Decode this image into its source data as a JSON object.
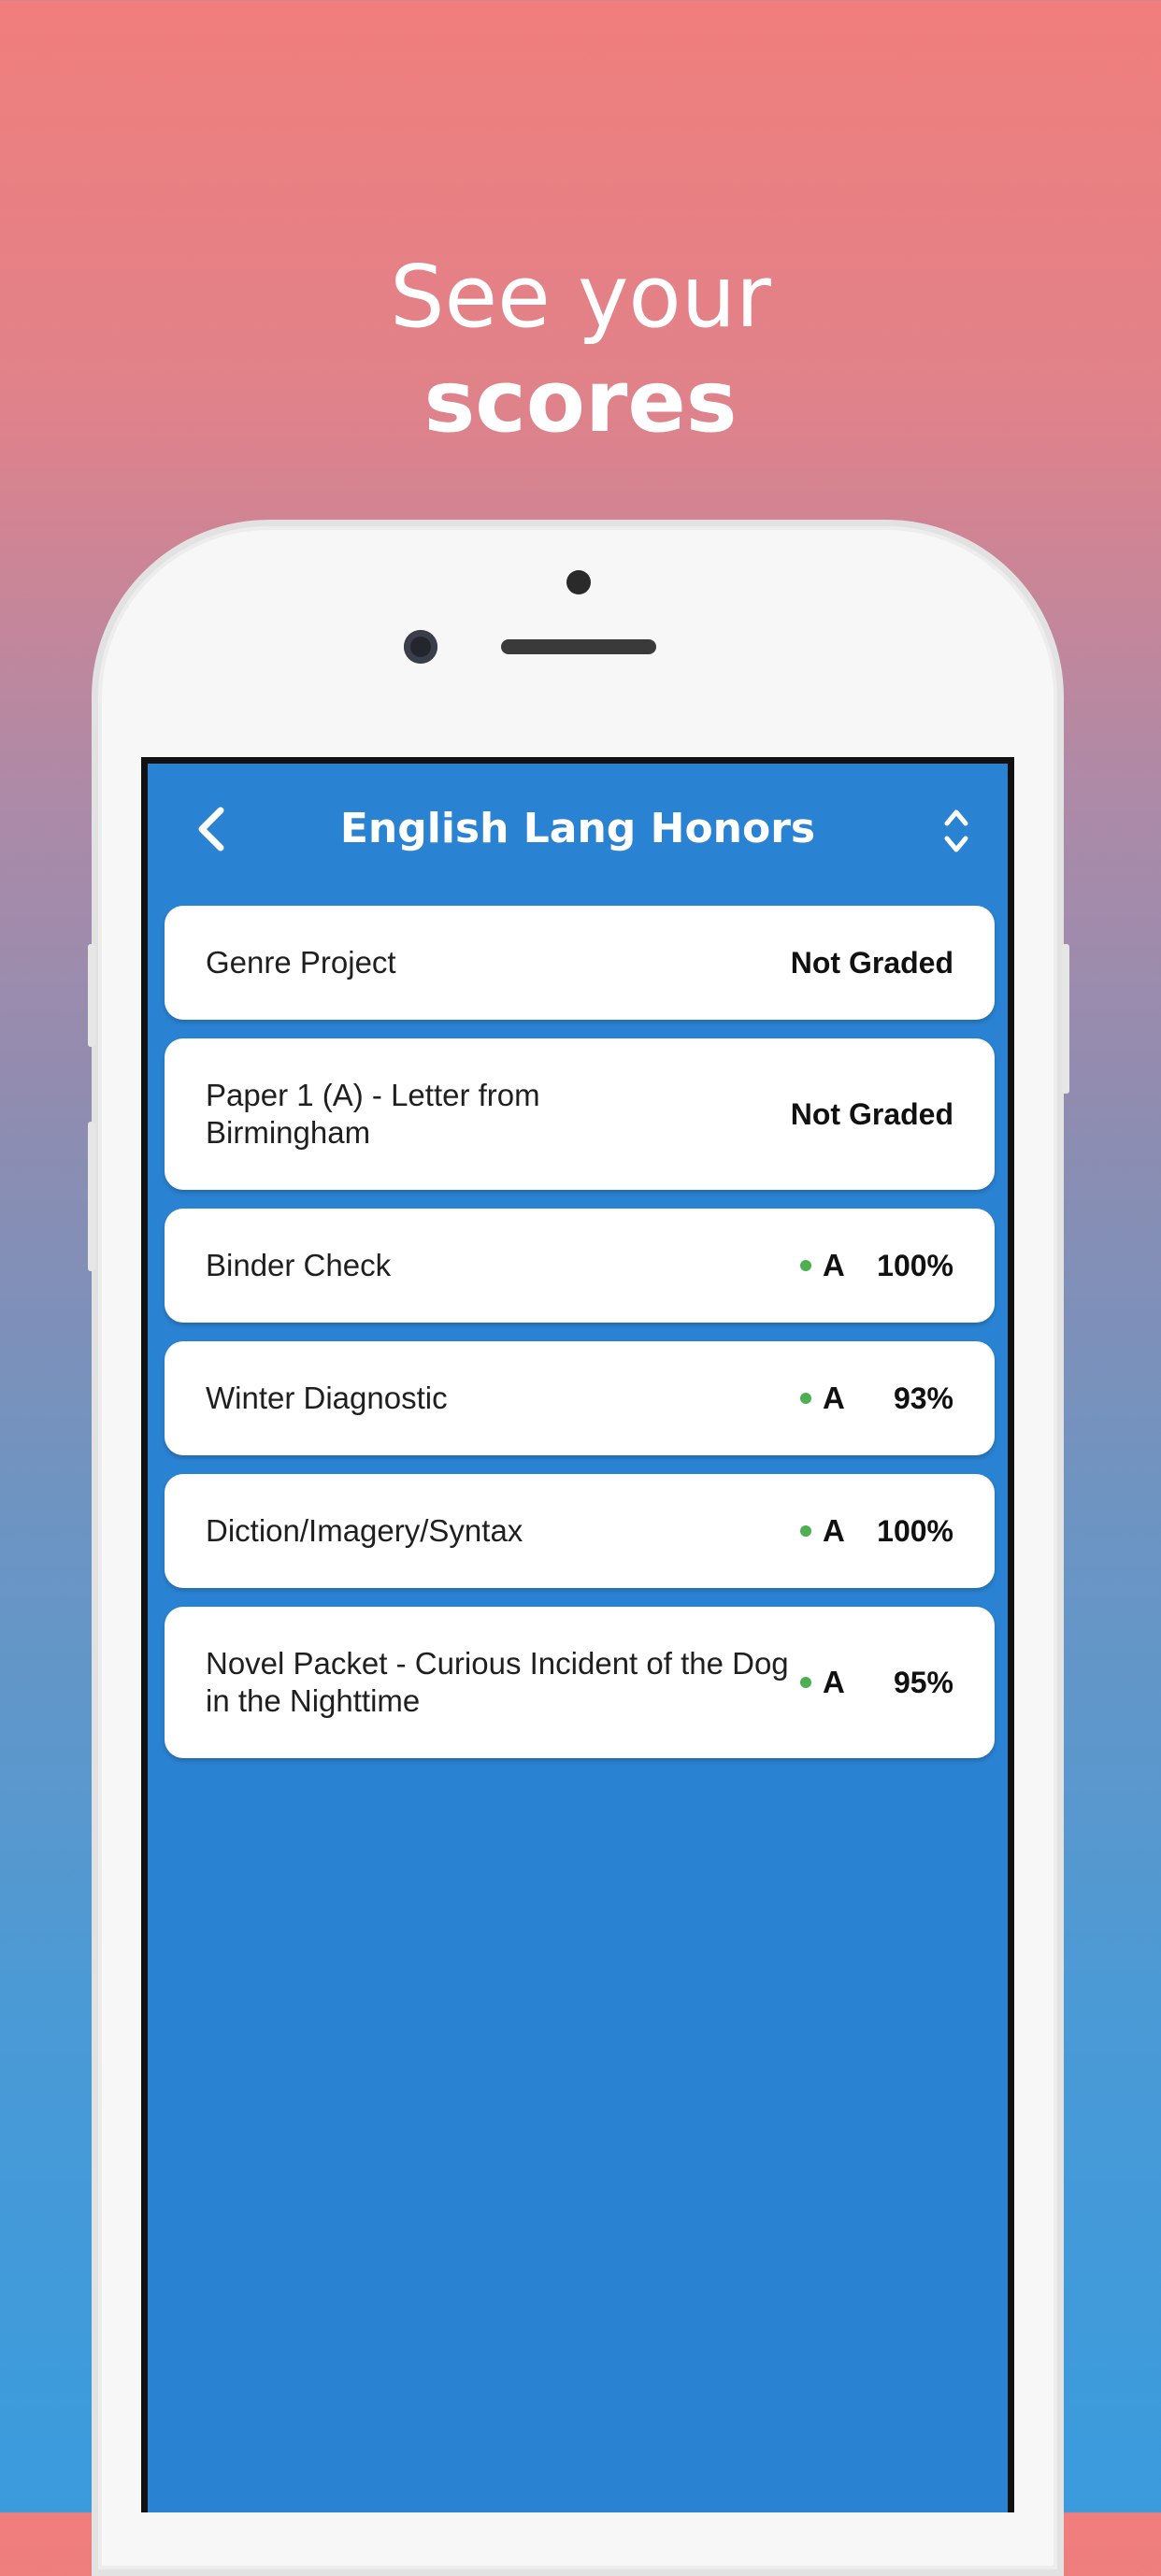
{
  "headline": {
    "line1": "See your",
    "line2": "scores"
  },
  "screen": {
    "nav": {
      "title": "English Lang Honors",
      "back_icon": "chevron-left-icon",
      "sort_icon": "sort-updown-icon"
    },
    "assignments": [
      {
        "name": "Genre Project",
        "status": "Not Graded"
      },
      {
        "name": "Paper 1 (A) - Letter from Birmingham",
        "status": "Not Graded"
      },
      {
        "name": "Binder Check",
        "grade": "A",
        "percent": "100%"
      },
      {
        "name": "Winter Diagnostic",
        "grade": "A",
        "percent": "93%"
      },
      {
        "name": "Diction/Imagery/Syntax",
        "grade": "A",
        "percent": "100%"
      },
      {
        "name": "Novel Packet - Curious Incident of the Dog in the Nighttime",
        "grade": "A",
        "percent": "95%"
      }
    ]
  },
  "colors": {
    "screen_bg": "#2A82D2",
    "grade_dot": "#4CAF50",
    "card_bg": "#FFFFFF"
  }
}
